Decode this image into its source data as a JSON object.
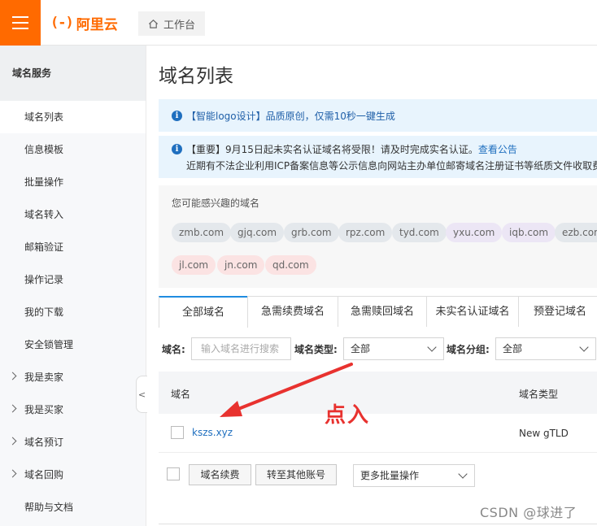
{
  "header": {
    "logo_mark": "(-)",
    "logo_text": "阿里云",
    "workbench_label": "工作台"
  },
  "sidebar": {
    "title": "域名服务",
    "items": [
      {
        "label": "域名列表"
      },
      {
        "label": "信息模板"
      },
      {
        "label": "批量操作"
      },
      {
        "label": "域名转入"
      },
      {
        "label": "邮箱验证"
      },
      {
        "label": "操作记录"
      },
      {
        "label": "我的下载"
      },
      {
        "label": "安全锁管理"
      },
      {
        "label": "我是卖家"
      },
      {
        "label": "我是买家"
      },
      {
        "label": "域名预订"
      },
      {
        "label": "域名回购"
      },
      {
        "label": "帮助与文档"
      }
    ],
    "collapse_glyph": "<"
  },
  "main": {
    "title": "域名列表",
    "notice1": "【智能logo设计】品质原创，仅需10秒一键生成",
    "notice2_line1": "【重要】9月15日起未实名认证域名将受限！请及时完成实名认证。",
    "notice2_link": "查看公告",
    "notice2_line2": "近期有不法企业利用ICP备案信息等公示信息向网站主办单位邮寄域名注册证书等纸质文件收取费",
    "suggest_title": "您可能感兴趣的域名",
    "suggest_chips": [
      "zmb.com",
      "gjq.com",
      "grb.com",
      "rpz.com",
      "tyd.com",
      "yxu.com",
      "iqb.com",
      "ezb.com",
      "jl.com",
      "jn.com",
      "qd.com"
    ],
    "tabs": [
      "全部域名",
      "急需续费域名",
      "急需赎回域名",
      "未实名认证域名",
      "预登记域名"
    ],
    "filter": {
      "domain_label": "域名:",
      "domain_placeholder": "输入域名进行搜索",
      "type_label": "域名类型:",
      "type_value": "全部",
      "group_label": "域名分组:",
      "group_value": "全部"
    },
    "table": {
      "col_domain": "域名",
      "col_type": "域名类型",
      "rows": [
        {
          "domain": "kszs.xyz",
          "type": "New gTLD"
        }
      ]
    },
    "actions": {
      "renew": "域名续费",
      "transfer": "转至其他账号",
      "batch": "更多批量操作"
    }
  },
  "annotation": {
    "text": "点入",
    "color": "#e8322f"
  },
  "watermark": "CSDN @球进了",
  "colors": {
    "brand": "#ff6a00",
    "link": "#1f6fbf",
    "tab_active": "#1f8ce0"
  }
}
